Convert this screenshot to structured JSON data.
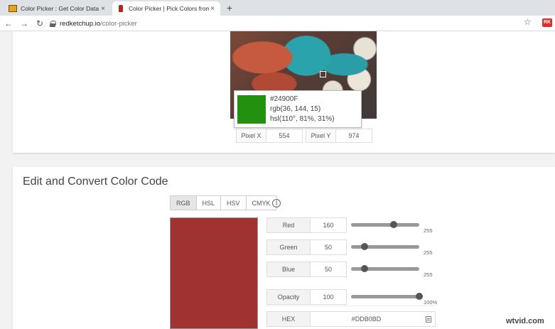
{
  "browser": {
    "tabs": [
      {
        "title": "Color Picker : Get Color Data fro",
        "close": "×"
      },
      {
        "title": "Color Picker | Pick Colors from Im",
        "close": "×"
      }
    ],
    "new_tab": "+",
    "nav": {
      "back": "←",
      "forward": "→",
      "reload": "↻"
    },
    "url_host": "redketchup.io",
    "url_path": "/color-picker",
    "bookmark": "☆",
    "extension_label": "RK"
  },
  "picker": {
    "hover_color": "#24900F",
    "tooltip": {
      "hex": "#24900F",
      "rgb": "rgb(36, 144, 15)",
      "hsl": "hsl(110°, 81%, 31%)"
    },
    "pixel_x_label": "Pixel X",
    "pixel_x": "554",
    "pixel_y_label": "Pixel Y",
    "pixel_y": "974"
  },
  "editor": {
    "title": "Edit and Convert Color Code",
    "modes": [
      "RGB",
      "HSL",
      "HSV",
      "CMYK"
    ],
    "active_mode": "RGB",
    "info": "i",
    "swatch_color": "#A03232",
    "channels": [
      {
        "label": "Red",
        "value": "160",
        "max": "255",
        "fraction": 0.627
      },
      {
        "label": "Green",
        "value": "50",
        "max": "255",
        "fraction": 0.196
      },
      {
        "label": "Blue",
        "value": "50",
        "max": "255",
        "fraction": 0.196
      }
    ],
    "opacity": {
      "label": "Opacity",
      "value": "100",
      "max": "100%",
      "fraction": 1.0
    },
    "hex": {
      "label": "HEX",
      "value": "#DDB0BD"
    }
  },
  "watermark": "wtvid.com"
}
